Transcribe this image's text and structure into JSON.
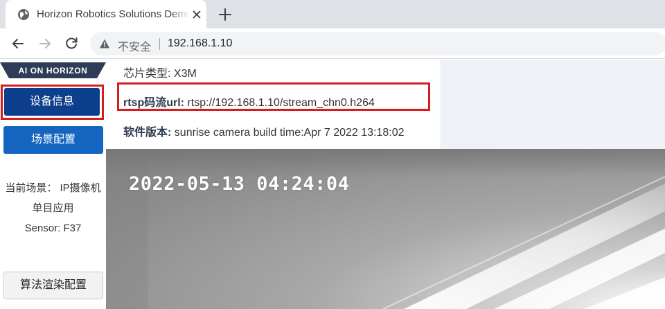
{
  "browser": {
    "tab_title": "Horizon Robotics Solutions Demo",
    "security_label": "不安全",
    "url": "192.168.1.10"
  },
  "sidebar": {
    "brand": "AI ON HORIZON",
    "device_info_label": "设备信息",
    "scene_config_label": "场景配置",
    "scene_line1": "当前场景： IP摄像机",
    "scene_line2": "单目应用",
    "scene_line3": "Sensor: F37",
    "render_config_label": "算法渲染配置"
  },
  "info": {
    "chip_label": "芯片类型:",
    "chip_value": "X3M",
    "rtsp_label": "rtsp码流url:",
    "rtsp_value": "rtsp://192.168.1.10/stream_chn0.h264",
    "version_label": "软件版本:",
    "version_value": "sunrise camera build time:Apr 7 2022 13:18:02"
  },
  "video": {
    "timestamp": "2022-05-13 04:24:04"
  },
  "colors": {
    "primary": "#1565c0",
    "primary_active": "#0d3f8c",
    "highlight": "#d71d1d"
  },
  "icons": [
    "globe-icon",
    "close-icon",
    "plus-icon",
    "back-arrow-icon",
    "forward-arrow-icon",
    "reload-icon",
    "warning-icon"
  ]
}
